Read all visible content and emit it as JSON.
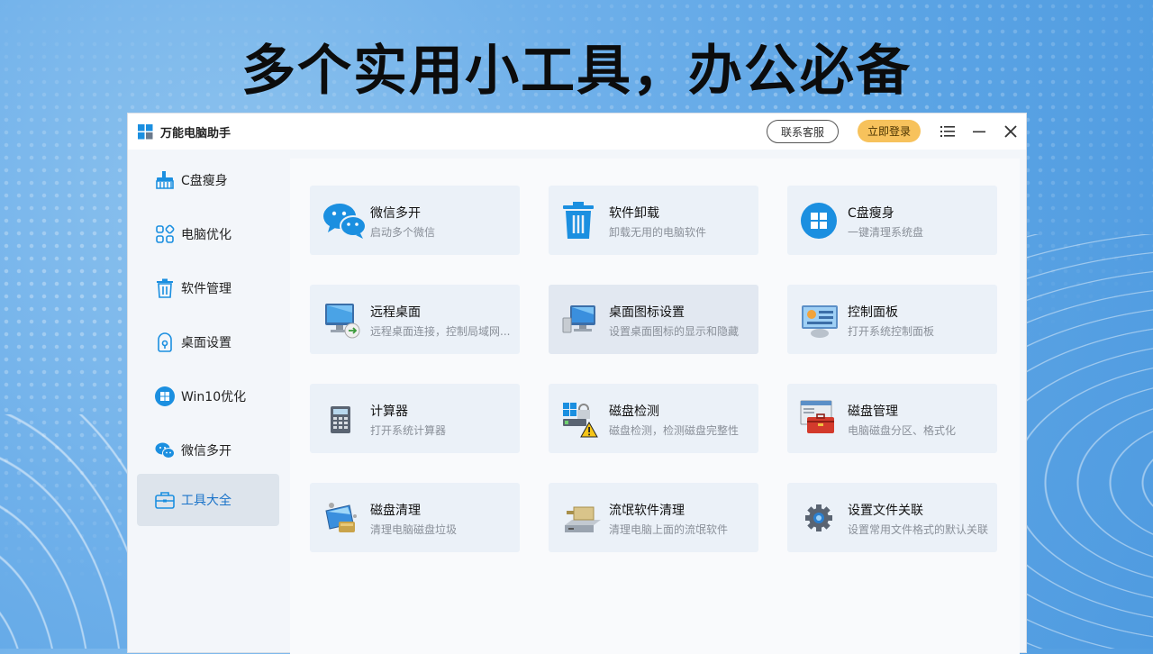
{
  "headline": "多个实用小工具，办公必备",
  "window": {
    "title": "万能电脑助手",
    "contact_button": "联系客服",
    "login_button": "立即登录"
  },
  "sidebar": {
    "items": [
      {
        "label": "C盘瘦身",
        "icon": "broom-icon"
      },
      {
        "label": "电脑优化",
        "icon": "grid-optimize-icon"
      },
      {
        "label": "软件管理",
        "icon": "trash-icon"
      },
      {
        "label": "桌面设置",
        "icon": "desktop-settings-icon"
      },
      {
        "label": "Win10优化",
        "icon": "windows-icon"
      },
      {
        "label": "微信多开",
        "icon": "wechat-icon"
      },
      {
        "label": "工具大全",
        "icon": "toolbox-icon",
        "active": true
      }
    ]
  },
  "tools": [
    {
      "title": "微信多开",
      "desc": "启动多个微信",
      "icon": "wechat-icon"
    },
    {
      "title": "软件卸载",
      "desc": "卸载无用的电脑软件",
      "icon": "trash-icon"
    },
    {
      "title": "C盘瘦身",
      "desc": "一键清理系统盘",
      "icon": "windows-icon"
    },
    {
      "title": "远程桌面",
      "desc": "远程桌面连接，控制局域网...",
      "icon": "remote-desktop-icon"
    },
    {
      "title": "桌面图标设置",
      "desc": "设置桌面图标的显示和隐藏",
      "icon": "desktop-icon"
    },
    {
      "title": "控制面板",
      "desc": "打开系统控制面板",
      "icon": "control-panel-icon"
    },
    {
      "title": "计算器",
      "desc": "打开系统计算器",
      "icon": "calculator-icon"
    },
    {
      "title": "磁盘检测",
      "desc": "磁盘检测，检测磁盘完整性",
      "icon": "disk-check-icon"
    },
    {
      "title": "磁盘管理",
      "desc": "电脑磁盘分区、格式化",
      "icon": "disk-manage-icon"
    },
    {
      "title": "磁盘清理",
      "desc": "清理电脑磁盘垃圾",
      "icon": "disk-clean-icon"
    },
    {
      "title": "流氓软件清理",
      "desc": "清理电脑上面的流氓软件",
      "icon": "rogue-software-icon"
    },
    {
      "title": "设置文件关联",
      "desc": "设置常用文件格式的默认关联",
      "icon": "gear-icon"
    }
  ],
  "colors": {
    "accent": "#1a73c9",
    "login_bg": "#f7c25c",
    "icon_blue": "#1b8fe0"
  }
}
